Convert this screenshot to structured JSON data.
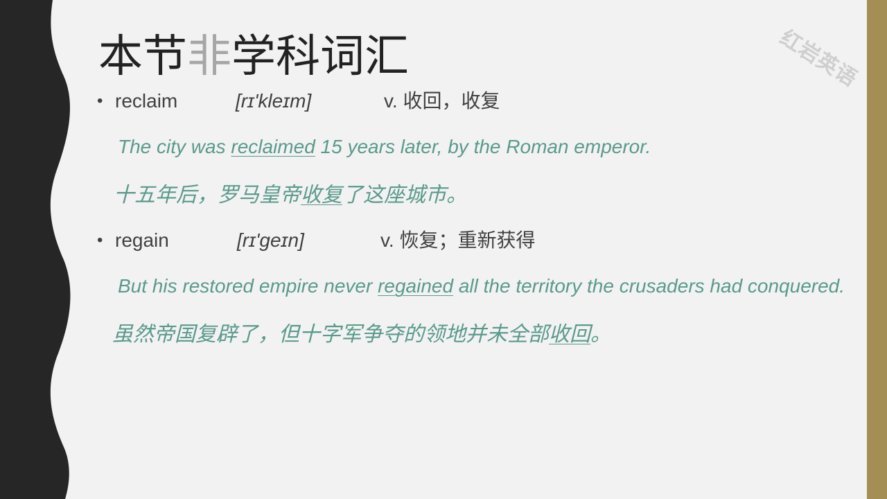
{
  "watermark": "红岩英语",
  "title": {
    "part1": "本节",
    "part2": "非",
    "part3": "学科词汇"
  },
  "items": [
    {
      "bullet": "•",
      "word": "reclaim",
      "phonetic": "[rɪ'kleɪm]",
      "meaning": "v. 收回，收复",
      "example_en": {
        "before": "The city was ",
        "key": "reclaimed",
        "after": " 15 years later, by the Roman emperor."
      },
      "example_zh": {
        "before": "十五年后，罗马皇帝",
        "key": "收复",
        "after": "了这座城市。"
      }
    },
    {
      "bullet": "•",
      "word": "regain",
      "phonetic": "[rɪ'geɪn]",
      "meaning": "v. 恢复；重新获得",
      "example_en": {
        "before": "But his restored empire never ",
        "key": "regained",
        "after": " all the territory the crusaders had conquered."
      },
      "example_zh": {
        "before": "虽然帝国复辟了，但十字军争夺的领地并未全部",
        "key": "收回",
        "after": "。"
      }
    }
  ],
  "colors": {
    "accent_green": "#5a9a8c",
    "side_gold": "#a58e54",
    "side_dark": "#262626"
  }
}
